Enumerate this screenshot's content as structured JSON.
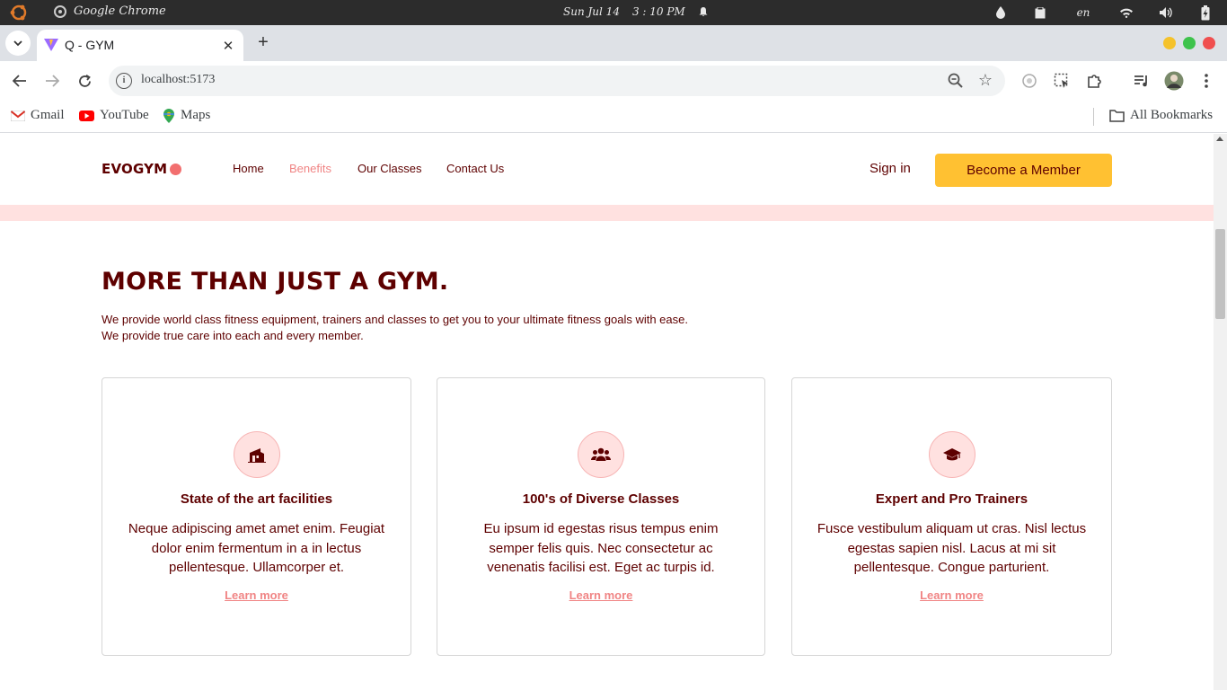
{
  "os": {
    "app_name": "Google Chrome",
    "date": "Sun Jul 14",
    "time": "3 : 10 PM",
    "language": "en"
  },
  "browser": {
    "tab_title": "Q - GYM",
    "url": "localhost:5173",
    "bookmarks": [
      "Gmail",
      "YouTube",
      "Maps"
    ],
    "all_bookmarks": "All Bookmarks"
  },
  "site": {
    "logo": "EVOGYM",
    "nav": [
      "Home",
      "Benefits",
      "Our Classes",
      "Contact Us"
    ],
    "active_nav": "Benefits",
    "sign_in": "Sign in",
    "cta": "Become a Member",
    "heading": "MORE THAN JUST A GYM.",
    "intro_line1": "We provide world class fitness equipment, trainers and classes to get you to your ultimate fitness goals with ease.",
    "intro_line2": "We provide true care into each and every member.",
    "cards": [
      {
        "icon": "home-modern-icon",
        "title": "State of the art facilities",
        "body": "Neque adipiscing amet amet enim. Feugiat dolor enim fermentum in a in lectus pellentesque. Ullamcorper et.",
        "link": "Learn more"
      },
      {
        "icon": "user-group-icon",
        "title": "100's of Diverse Classes",
        "body": "Eu ipsum id egestas risus tempus enim semper felis quis. Nec consectetur ac venenatis facilisi est. Eget ac turpis id.",
        "link": "Learn more"
      },
      {
        "icon": "academic-cap-icon",
        "title": "Expert and Pro Trainers",
        "body": "Fusce vestibulum aliquam ut cras. Nisl lectus egestas sapien nisl. Lacus at mi sit pellentesque. Congue parturient.",
        "link": "Learn more"
      }
    ]
  },
  "colors": {
    "primary": "#5e0000",
    "accent": "#f08484",
    "secondary": "#ffc132",
    "pink_light": "#ffe1e0"
  }
}
